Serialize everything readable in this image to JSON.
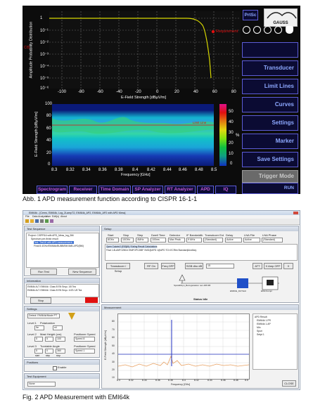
{
  "figure1": {
    "top_plot": {
      "y_label": "Amplitude Probability Distribution",
      "x_label": "E-Field Strength [dBµV/m]",
      "y_ticks": [
        "1",
        "10⁻¹",
        "10⁻²",
        "10⁻³",
        "10⁻⁴",
        "10⁻⁵",
        "10⁻⁶"
      ],
      "x_ticks": [
        "-100",
        "-80",
        "-60",
        "-40",
        "-20",
        "0",
        "20",
        "40",
        "60",
        "80"
      ],
      "marker_label": "Requirement",
      "left_annotation": "CIS",
      "curve_color": "#d8d800",
      "marker_color": "#e01010"
    },
    "spectrogram": {
      "y_label": "E-Field Strength [dBµV/m]",
      "x_label": "Frequency [GHz]",
      "y_ticks": [
        "100",
        "80",
        "60",
        "40",
        "20",
        "0"
      ],
      "x_ticks": [
        "8.3",
        "8.32",
        "8.34",
        "8.36",
        "8.38",
        "8.4",
        "8.42",
        "8.44",
        "8.46",
        "8.48",
        "8.5"
      ],
      "limit_label": "Limit Line",
      "colorbar_ticks": [
        "50",
        "40",
        "30",
        "20",
        "10",
        "0"
      ],
      "colorbar_label": "%"
    },
    "logo": "GAUSS",
    "top_buttons": {
      "prtsc": "PrtSc"
    },
    "right_buttons": [
      "",
      "Transducer",
      "Limit Lines",
      "Curves",
      "Settings",
      "Marker",
      "Save Settings",
      "Trigger Mode"
    ],
    "bottom_tabs": [
      "Spectrogram",
      "Receiver",
      "Time Domain",
      "SP Analyzer",
      "RT Analyzer",
      "APD",
      "IQ"
    ],
    "run_label": "RUN",
    "caption": "Abb. 1  APD measurement function according to CISPR 16-1-1"
  },
  "figure2": {
    "title_bar": "EMI64k - [Cerns, EMI64k, Log_2LampT2, EMI64k_AP2, EMI64k_AP2 with APD Mess]",
    "menu": [
      "File",
      "Data Analysis",
      "User",
      "Edit(s)",
      "About"
    ],
    "test_sequence": {
      "title": "Test Sequence",
      "items": [
        "Project: CISPR16 with APD_Mess_log_BM",
        "Spectrum pre-finish result",
        "Test: Test16 with APD measurement...",
        "Final 8.4GHz/EMI64k/BUBB/BM 8dB-APD(BM)"
      ],
      "run_button": "Run Test",
      "new_button": "New Sequence"
    },
    "info": {
      "title": "Information",
      "lines": [
        "EMI64k ALT: EMI64k / Class B EN Sequ. 1/8 Tea",
        "EMI64k ALT: EMI64k / Class B EN Sequ. 1/4Tc 1/8 Tea"
      ],
      "stop_button": "Stop",
      "status_color": "#e01010"
    },
    "settings": {
      "title": "Settings",
      "antenna": "Detect: EMI64k/Mode PT",
      "rows": [
        {
          "label": "Level 1",
          "col1": "Polarization",
          "v1": "5e",
          "v2": "nil"
        },
        {
          "label": "Level 2",
          "col1": "Mast Height (cm)",
          "v1": "5",
          "v2": "5",
          "v3": "100",
          "opt": "Positioner Speed",
          "optv": "Speed 8"
        },
        {
          "label": "Level 3",
          "col1": "Turntable Angle",
          "v1": "5",
          "v2": "0",
          "v3": "360",
          "opt": "Positioner Speed",
          "optv": "Speed 1"
        }
      ],
      "units": [
        "start",
        "step",
        "stop"
      ]
    },
    "positions": {
      "title": "Positions",
      "enable": "Enable"
    },
    "test_equipment": {
      "title": "Test Equipment",
      "value": "None"
    },
    "setup": {
      "title": "Setup",
      "headers": [
        "Start",
        "Stop",
        "Step",
        "Dwell Time",
        "Detector",
        "IF Bandwidth",
        "Transducer Ext",
        "Delay",
        "LNA File",
        "LNA Phase"
      ],
      "values": [
        "8GHz",
        "10GHz",
        "4MHz",
        "100ms",
        "Max Peak",
        "9 MHz",
        "(Standard)",
        "Active",
        "Active",
        "(Standard)"
      ],
      "info_lines": [
        "Open Calorte2 (E53j8f) / Ealing Result Calculations",
        "Final 1.8LANFO2504r EMIFOPC2tBF VMG@APD 1@APD TCh ECRtm Standard|Ancillary"
      ],
      "buttons": [
        "Transducer / Setup",
        "RF On",
        "Freq OFF",
        "SGB dbu dB",
        "15",
        "ATT",
        "X Amp OFF",
        "X"
      ],
      "diagram_labels": [
        "Spuiddifsyn_Bezugsstation rem-DB DB",
        "EMI64k_DUTHAI",
        "EMV-Kompr"
      ],
      "status_title": "Status Idle"
    },
    "measurement": {
      "title": "Measurement",
      "y_label": "E-Field Strength [dBµV/m]",
      "x_label": "Frequency [GHz]",
      "y_ticks": [
        "80",
        "70",
        "60",
        "50",
        "40",
        "30",
        "20",
        "10"
      ],
      "x_ticks": [
        "8.3",
        "8.32",
        "8.34",
        "8.36",
        "8.38",
        "8.4",
        "8.42",
        "8.44",
        "8.46",
        "8.48",
        "8.5"
      ],
      "legend": [
        "APD Result",
        "EMI64k 1.PR",
        "EMI64k 1.AP",
        "Min",
        "Spuri",
        "Setpt 1"
      ],
      "close_button": "CLOSE",
      "trace_color": "#e8a060",
      "peak_color": "#2030c0",
      "limit_color": "#2030c0"
    },
    "caption": "Fig. 2  APD Measurement with EMI64k"
  }
}
